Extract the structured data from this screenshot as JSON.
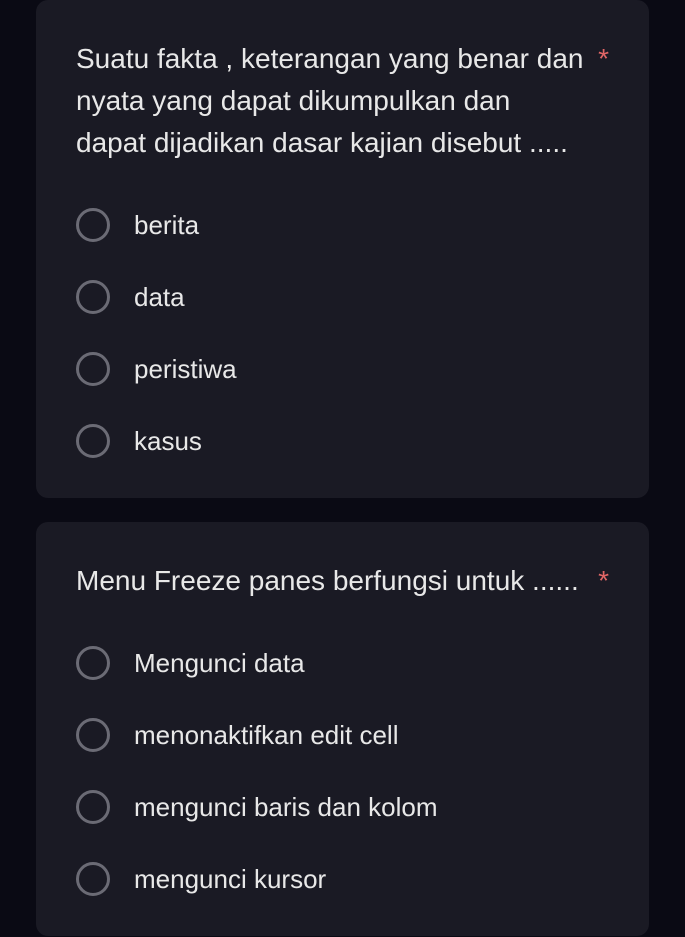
{
  "questions": [
    {
      "text": "Suatu fakta , keterangan yang benar dan nyata yang dapat dikumpulkan dan dapat dijadikan dasar kajian disebut .....",
      "required": "*",
      "options": [
        {
          "label": "berita"
        },
        {
          "label": "data"
        },
        {
          "label": "peristiwa"
        },
        {
          "label": "kasus"
        }
      ]
    },
    {
      "text": "Menu Freeze panes berfungsi untuk ......",
      "required": "*",
      "options": [
        {
          "label": "Mengunci data"
        },
        {
          "label": "menonaktifkan edit cell"
        },
        {
          "label": "mengunci baris dan kolom"
        },
        {
          "label": "mengunci kursor"
        }
      ]
    }
  ]
}
